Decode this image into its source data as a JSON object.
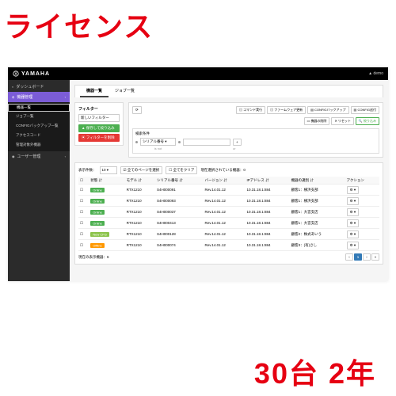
{
  "overlay": {
    "top": "ライセンス",
    "bottom": "30台 2年"
  },
  "header": {
    "brand": "YAMAHA",
    "user_prefix": "▲",
    "user": "demo"
  },
  "sidebar": {
    "dashboard": "ダッシュボード",
    "device_mgmt": "機器管理",
    "sub": {
      "list": "機器一覧",
      "jobs": "ジョブ一覧",
      "config": "CONFIGバックアップ一覧",
      "access": "アクセスコード",
      "exclude": "管理対象外機器"
    },
    "user_mgmt": "ユーザー管理"
  },
  "tabs": {
    "devices": "機器一覧",
    "jobs": "ジョブ一覧"
  },
  "filter": {
    "title": "フィルター",
    "select": "新しいフィルター",
    "save": "▲ 保存して絞り込み",
    "delete": "▣ フィルターを削除"
  },
  "top_actions": {
    "refresh": "⟳",
    "cmd": "コマンド実行",
    "fw": "ファームウェア更新",
    "cfg_backup": "CONFIGバックアップ",
    "cfg_send": "CONFIG送付",
    "dereg": "機器の削除",
    "reset": "✕ リセット",
    "filter_btn": "絞り込み"
  },
  "cond": {
    "title": "検索条件",
    "field": "シリアル番号 ▾",
    "op1": "is not",
    "val": "",
    "conj": "or",
    "add": "+"
  },
  "table": {
    "per_label": "表示件数：",
    "per_value": "10 ▾",
    "sel_all": "全てのページを選択",
    "sel_clear": "全てをクリア",
    "sel_count_label": "現在選択されている機器：",
    "sel_count": "0",
    "cols": {
      "status": "状態 ⇵",
      "model": "モデル ⇵",
      "serial": "シリアル番号 ⇵",
      "ver": "バージョン ⇵",
      "ip": "IPアドレス ⇵",
      "label": "機器の識別 ⇵",
      "action": "アクション"
    },
    "rows": [
      {
        "status": "Online",
        "cls": "online",
        "model": "RTX1210",
        "serial": "S4H000091",
        "ver": "Rev.14.01.12",
        "ip": "10.31.18.1:884",
        "label": "顧客1：横浜支部",
        "act": "⚙ ▾"
      },
      {
        "status": "Online",
        "cls": "online",
        "model": "RTX1210",
        "serial": "S4H000093",
        "ver": "Rev.14.01.12",
        "ip": "10.31.18.1:884",
        "label": "顧客1：横浜支部",
        "act": "⚙ ▾"
      },
      {
        "status": "Online",
        "cls": "online",
        "model": "RTX1210",
        "serial": "S4H000037",
        "ver": "Rev.14.01.12",
        "ip": "10.31.18.1:884",
        "label": "顧客1：大宮支店",
        "act": "⚙ ▾"
      },
      {
        "status": "Online",
        "cls": "online",
        "model": "RTX1210",
        "serial": "S4H000413",
        "ver": "Rev.14.01.12",
        "ip": "10.31.18.1:884",
        "label": "顧客1：大宮支店",
        "act": "⚙ ▾"
      },
      {
        "status": "New CFG",
        "cls": "newcfg",
        "model": "RTX1210",
        "serial": "S4H000128",
        "ver": "Rev.14.01.12",
        "ip": "10.31.18.1:884",
        "label": "顧客2：株式あいう",
        "act": "⚙ ▾"
      },
      {
        "status": "Offline",
        "cls": "offline",
        "model": "RTX1210",
        "serial": "S4H000074",
        "ver": "Rev.14.01.12",
        "ip": "10.31.18.1:884",
        "label": "顧客3：(有)さし",
        "act": "⚙ ▾"
      }
    ],
    "footer_note": "現在の表示機器：6",
    "pager": {
      "prev": "‹",
      "p1": "1",
      "next": "›",
      "last": "»"
    }
  }
}
